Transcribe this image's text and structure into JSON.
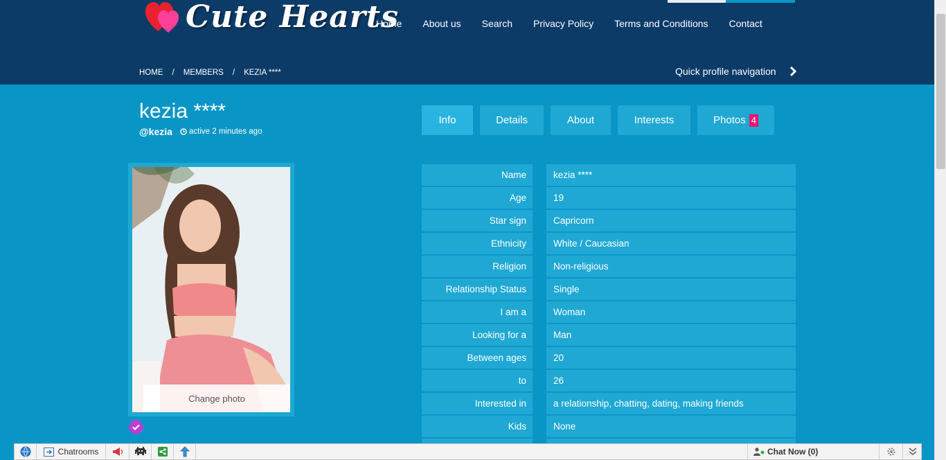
{
  "brand": {
    "name": "Cute Hearts"
  },
  "nav": [
    "Home",
    "About us",
    "Search",
    "Privacy Policy",
    "Terms and Conditions",
    "Contact"
  ],
  "breadcrumb": [
    "HOME",
    "MEMBERS",
    "KEZIA ****"
  ],
  "breadcrumb_sep": "/",
  "quick_nav": "Quick profile navigation",
  "profile": {
    "name": "kezia ****",
    "handle": "@kezia",
    "active": "active 2 minutes ago",
    "change_photo": "Change photo"
  },
  "tabs": {
    "info": "Info",
    "details": "Details",
    "about": "About",
    "interests": "Interests",
    "photos": "Photos",
    "photos_count": "4"
  },
  "info_rows": [
    {
      "label": "Name",
      "value": "kezia ****"
    },
    {
      "label": "Age",
      "value": "19"
    },
    {
      "label": "Star sign",
      "value": "Capricorn"
    },
    {
      "label": "Ethnicity",
      "value": "White / Caucasian"
    },
    {
      "label": "Religion",
      "value": "Non-religious"
    },
    {
      "label": "Relationship Status",
      "value": "Single"
    },
    {
      "label": "I am a",
      "value": "Woman"
    },
    {
      "label": "Looking for a",
      "value": "Man"
    },
    {
      "label": "Between ages",
      "value": "20"
    },
    {
      "label": "to",
      "value": "26"
    },
    {
      "label": "Interested in",
      "value": "a relationship, chatting, dating, making friends"
    },
    {
      "label": "Kids",
      "value": "None"
    },
    {
      "label": "",
      "value": ""
    }
  ],
  "toolbar": {
    "chatrooms": "Chatrooms",
    "chat_now": "Chat Now (0)"
  },
  "colors": {
    "header_bg": "#0c3b68",
    "page_bg": "#0996c6",
    "cell_bg": "#1fa8d3",
    "badge": "#e6176e",
    "verified": "#c13ad6"
  }
}
